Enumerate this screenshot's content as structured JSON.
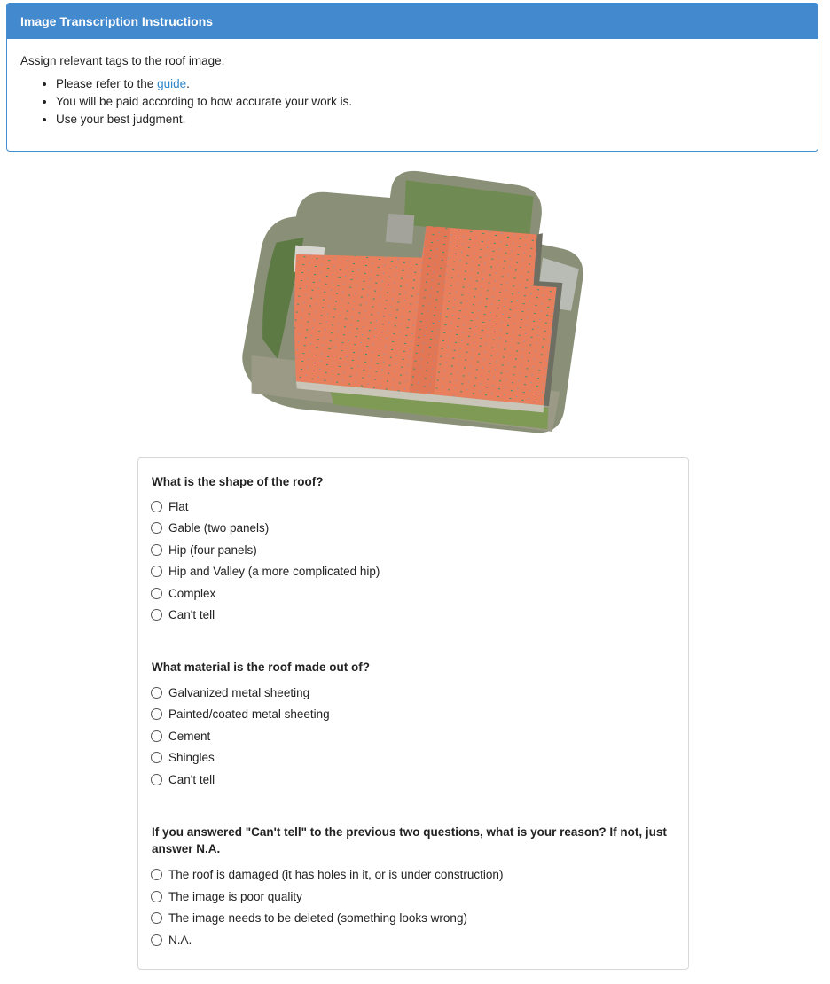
{
  "instructions": {
    "title": "Image Transcription Instructions",
    "intro": "Assign relevant tags to the roof image.",
    "bullet1_prefix": "Please refer to the ",
    "bullet1_link": "guide",
    "bullet1_suffix": ".",
    "bullet2": "You will be paid according to how accurate your work is.",
    "bullet3": "Use your best judgment."
  },
  "questions": [
    {
      "label": "What is the shape of the roof?",
      "options": [
        "Flat",
        "Gable (two panels)",
        "Hip (four panels)",
        "Hip and Valley (a more complicated hip)",
        "Complex",
        "Can't tell"
      ]
    },
    {
      "label": "What material is the roof made out of?",
      "options": [
        "Galvanized metal sheeting",
        "Painted/coated metal sheeting",
        "Cement",
        "Shingles",
        "Can't tell"
      ]
    },
    {
      "label": "If you answered \"Can't tell\" to the previous two questions, what is your reason? If not, just answer N.A.",
      "options": [
        "The roof is damaged (it has holes in it, or is under construction)",
        "The image is poor quality",
        "The image needs to be deleted (something looks wrong)",
        "N.A."
      ]
    }
  ],
  "colors": {
    "header_bg": "#4289cd",
    "link": "#2f86c8",
    "roof": "#e8805e"
  }
}
